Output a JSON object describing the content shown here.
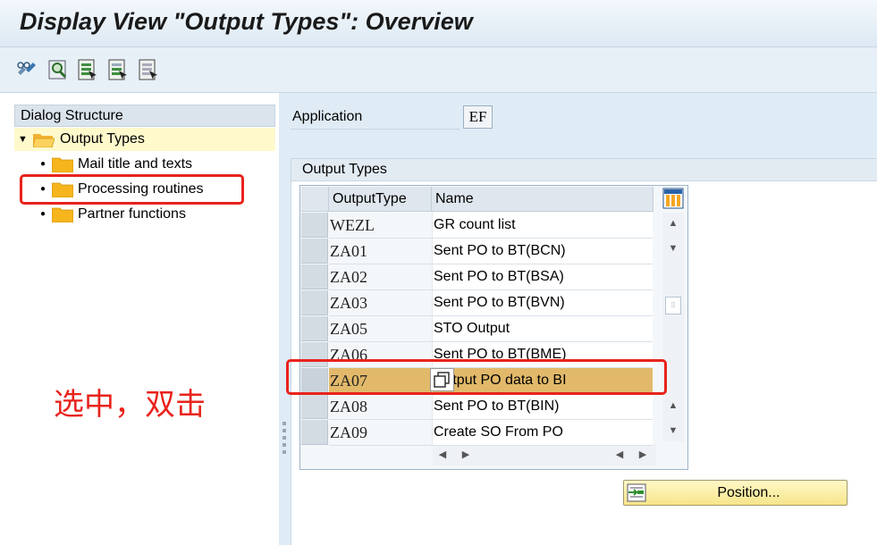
{
  "window": {
    "title": "Display View \"Output Types\": Overview"
  },
  "toolbar": {
    "buttons": [
      {
        "icon": "display-change-icon"
      },
      {
        "icon": "find-icon"
      },
      {
        "icon": "select-all-icon"
      },
      {
        "icon": "select-block-icon"
      },
      {
        "icon": "deselect-all-icon"
      }
    ]
  },
  "dialog_structure": {
    "header": "Dialog Structure",
    "root": {
      "label": "Output Types",
      "expanded": true
    },
    "children": [
      {
        "label": "Mail title and texts"
      },
      {
        "label": "Processing routines"
      },
      {
        "label": "Partner functions"
      }
    ]
  },
  "application": {
    "label": "Application",
    "value": "EF"
  },
  "output_types": {
    "section_title": "Output Types",
    "columns": {
      "type": "OutputType",
      "name": "Name"
    },
    "rows": [
      {
        "type": "WEZL",
        "name": "GR count list"
      },
      {
        "type": "ZA01",
        "name": "Sent PO to BT(BCN)"
      },
      {
        "type": "ZA02",
        "name": "Sent PO to BT(BSA)"
      },
      {
        "type": "ZA03",
        "name": "Sent PO to BT(BVN)"
      },
      {
        "type": "ZA05",
        "name": "STO Output"
      },
      {
        "type": "ZA06",
        "name": "Sent PO to BT(BME)"
      },
      {
        "type": "ZA07",
        "name": "Output PO data to BI",
        "highlighted": true
      },
      {
        "type": "ZA08",
        "name": "Sent PO to BT(BIN)"
      },
      {
        "type": "ZA09",
        "name": "Create SO From PO"
      }
    ]
  },
  "position_button": {
    "label": "Position..."
  },
  "annotation": {
    "text": "选中，双击",
    "color": "#e8231c"
  },
  "colors": {
    "highlight_row": "#e2b96a",
    "selected_tree": "#fff9cc",
    "accent_red": "#e8231c"
  }
}
